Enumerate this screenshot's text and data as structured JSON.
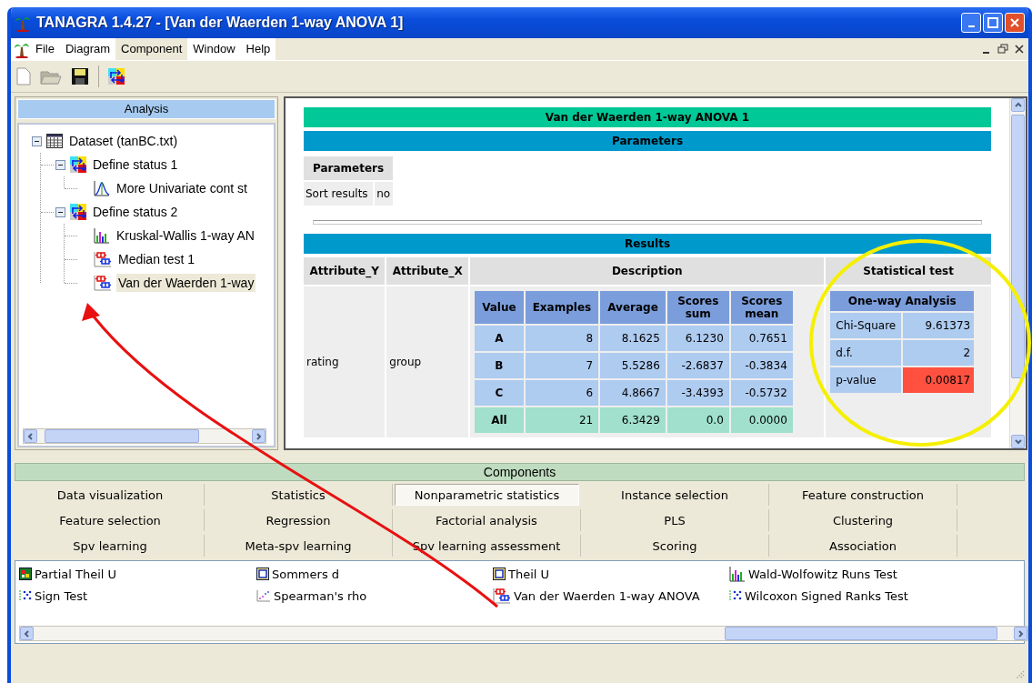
{
  "window": {
    "title": "TANAGRA 1.4.27 - [Van der Waerden 1-way ANOVA 1]"
  },
  "menu": [
    {
      "label": "File",
      "selected": false
    },
    {
      "label": "Diagram",
      "selected": false
    },
    {
      "label": "Component",
      "selected": true
    },
    {
      "label": "Window",
      "selected": false
    },
    {
      "label": "Help",
      "selected": false
    }
  ],
  "analysis": {
    "title": "Analysis",
    "tree": [
      {
        "label": "Dataset (tanBC.txt)",
        "kind": "dataset",
        "expanded": true,
        "selected": false,
        "children": [
          {
            "label": "Define status 1",
            "kind": "status",
            "expanded": true,
            "selected": false,
            "children": [
              {
                "label": "More Univariate cont st",
                "kind": "curve",
                "selected": false
              }
            ]
          },
          {
            "label": "Define status 2",
            "kind": "status",
            "expanded": true,
            "selected": false,
            "children": [
              {
                "label": "Kruskal-Wallis 1-way AN",
                "kind": "bars",
                "selected": false
              },
              {
                "label": "Median test 1",
                "kind": "boxplot",
                "selected": false
              },
              {
                "label": "Van der Waerden 1-way",
                "kind": "boxplot",
                "selected": true
              }
            ]
          }
        ]
      }
    ]
  },
  "report": {
    "title": "Van der Waerden 1-way ANOVA 1",
    "parameters": {
      "heading": "Parameters",
      "table_header": "Parameters",
      "rows": [
        [
          "Sort results",
          "no"
        ]
      ]
    },
    "results": {
      "heading": "Results",
      "columns": [
        "Attribute_Y",
        "Attribute_X",
        "Description",
        "Statistical test"
      ],
      "attribute_y": "rating",
      "attribute_x": "group",
      "description": {
        "columns": [
          "Value",
          "Examples",
          "Average",
          "Scores sum",
          "Scores mean"
        ],
        "rows": [
          {
            "kind": "group",
            "cells": [
              "A",
              "8",
              "8.1625",
              "6.1230",
              "0.7651"
            ]
          },
          {
            "kind": "group",
            "cells": [
              "B",
              "7",
              "5.5286",
              "-2.6837",
              "-0.3834"
            ]
          },
          {
            "kind": "group",
            "cells": [
              "C",
              "6",
              "4.8667",
              "-3.4393",
              "-0.5732"
            ]
          },
          {
            "kind": "total",
            "cells": [
              "All",
              "21",
              "6.3429",
              "0.0",
              "0.0000"
            ]
          }
        ]
      },
      "test": {
        "title": "One-way Analysis",
        "rows": [
          {
            "label": "Chi-Square",
            "value": "9.61373",
            "highlight": false
          },
          {
            "label": "d.f.",
            "value": "2",
            "highlight": false
          },
          {
            "label": "p-value",
            "value": "0.00817",
            "highlight": true
          }
        ]
      }
    }
  },
  "components": {
    "title": "Components",
    "tabs": [
      {
        "label": "Data visualization",
        "selected": false
      },
      {
        "label": "Statistics",
        "selected": false
      },
      {
        "label": "Nonparametric statistics",
        "selected": true
      },
      {
        "label": "Instance selection",
        "selected": false
      },
      {
        "label": "Feature construction",
        "selected": false
      },
      {
        "label": "Feature selection",
        "selected": false
      },
      {
        "label": "Regression",
        "selected": false
      },
      {
        "label": "Factorial analysis",
        "selected": false
      },
      {
        "label": "PLS",
        "selected": false
      },
      {
        "label": "Clustering",
        "selected": false
      },
      {
        "label": "Spv learning",
        "selected": false
      },
      {
        "label": "Meta-spv learning",
        "selected": false
      },
      {
        "label": "Spv learning assessment",
        "selected": false
      },
      {
        "label": "Scoring",
        "selected": false
      },
      {
        "label": "Association",
        "selected": false
      }
    ],
    "items": [
      {
        "label": "Partial Theil U",
        "kind": "matrix"
      },
      {
        "label": "Sommers d",
        "kind": "frame"
      },
      {
        "label": "Theil U",
        "kind": "frame"
      },
      {
        "label": "Wald-Wolfowitz Runs Test",
        "kind": "bars"
      },
      {
        "label": "Sign Test",
        "kind": "dots"
      },
      {
        "label": "Spearman's rho",
        "kind": "scatter"
      },
      {
        "label": "Van der Waerden 1-way ANOVA",
        "kind": "boxplot"
      },
      {
        "label": "Wilcoxon Signed Ranks Test",
        "kind": "dots"
      }
    ]
  }
}
